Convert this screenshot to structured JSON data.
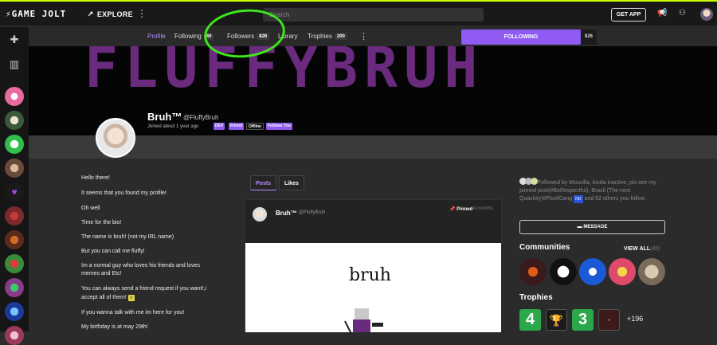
{
  "topbar": {
    "logo": "GAME JOLT",
    "explore": "EXPLORE",
    "search_placeholder": "Search",
    "get_app": "GET APP"
  },
  "subnav": {
    "tabs": [
      {
        "label": "Profile",
        "count": ""
      },
      {
        "label": "Following",
        "count": "40"
      },
      {
        "label": "Followers",
        "count": "826"
      },
      {
        "label": "Library",
        "count": ""
      },
      {
        "label": "Trophies",
        "count": "200"
      }
    ],
    "follow_label": "FOLLOWING",
    "follow_count": "826"
  },
  "banner": {
    "text": "FLUFFYBRUH"
  },
  "profile": {
    "name": "Bruh™",
    "handle": "@FluffyBruh",
    "joined": "Joined about 1 year ago",
    "badges": [
      "DEV",
      "Friend",
      "Offline",
      "Follows You"
    ]
  },
  "bio": [
    "Hello there!",
    "It seems that you found my profile!",
    "Oh well",
    "Time for the bio!",
    "The name is bruh! (not my IRL name)",
    "But you can call me fluffy!",
    "Im a normal guy who loves his friends and loves",
    "memes and Etc!",
    "You  can always send a friend request if you want!,i",
    "accept all of them!",
    "If you wanna talk  with me im here for you!",
    "My birthday is at may 29th!"
  ],
  "post_tabs": [
    "Posts",
    "Likes"
  ],
  "post": {
    "name": "Bruh™",
    "handle": "@FluffyBruh",
    "pinned": "Pinned",
    "ago": "4 months",
    "image_text": "bruh"
  },
  "right": {
    "followed_by": "Followed by Mouzilla, kinda inactive, pls see my pinned post(#BeRespectful), Brazil (The next Quackity)#FloofGang",
    "followed_by_tail": " and 92 others you follow",
    "message": "MESSAGE",
    "communities_title": "Communities",
    "view_all": "VIEW ALL",
    "view_all_count": "(45)",
    "trophies_title": "Trophies",
    "trophies_more": "+196"
  },
  "colors": {
    "accent": "#8f5bf2",
    "annotation": "#3de61a",
    "banner_text": "#6a2a7d"
  }
}
